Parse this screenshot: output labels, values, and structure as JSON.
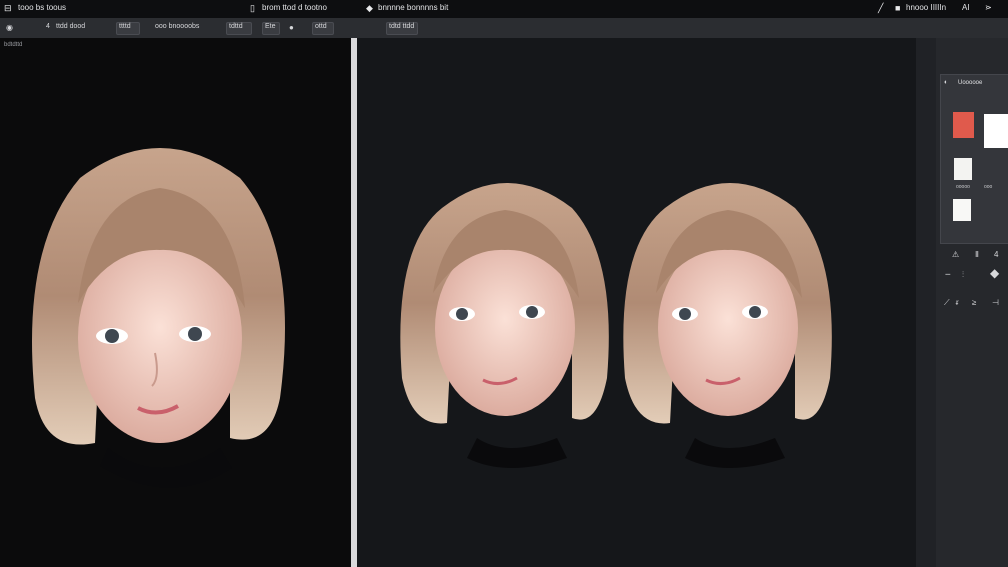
{
  "menubar": {
    "app_label": "tooo bs toous",
    "center_label": "brom ttod d tootno",
    "doc_label": "bnnnne bonnnns bit",
    "right_label": "hnooo IIIIIn",
    "right_glyphs": [
      "AI",
      "⋗"
    ]
  },
  "options": {
    "items": [
      "4",
      "ttdd dood",
      "ttttd",
      "ooo bnoooobs",
      "tdttd",
      "Ete",
      "ottd",
      "tdtd ttdd"
    ]
  },
  "breadcrumb": "bdtdttd",
  "panel": {
    "title": "Uoooooe",
    "labels": [
      "ooooo",
      "ooo"
    ],
    "swatch_colors": [
      "#e05a4c",
      "#ffffff",
      "#f3f3f1",
      "#f8f8f6"
    ],
    "tools": [
      "⚠",
      "Ⅱ",
      "4",
      "◆",
      "⟋",
      "ᵲ",
      "≥",
      "⊣"
    ]
  },
  "canvas": {
    "portrait_count_left": 1,
    "portrait_count_right": 2,
    "colors": {
      "hair": "#b08b74",
      "skin": "#f0c8bc",
      "lips": "#c9606b",
      "iris": "#3f4750",
      "shirt": "#0a0a0c"
    }
  }
}
